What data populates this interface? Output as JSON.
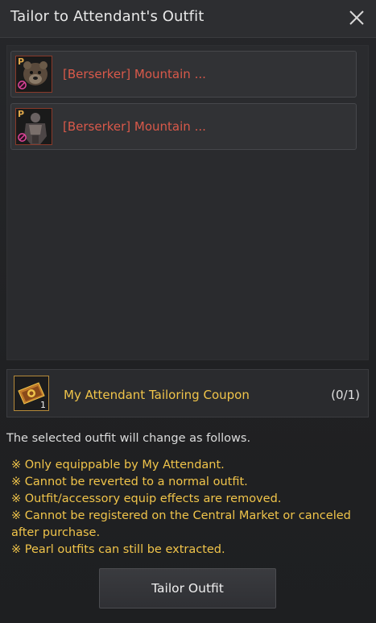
{
  "window": {
    "title": "Tailor to Attendant's Outfit",
    "close_icon": "close-icon"
  },
  "outfits": [
    {
      "name": "[Berserker] Mountain ...",
      "badge": "P",
      "icon": "bear-outfit-icon",
      "status_icon": "prohibited-icon"
    },
    {
      "name": "[Berserker] Mountain ...",
      "badge": "P",
      "icon": "armor-outfit-icon",
      "status_icon": "prohibited-icon"
    }
  ],
  "coupon": {
    "icon": "coupon-icon",
    "count_badge": "1",
    "name": "My Attendant Tailoring Coupon",
    "progress": "(0/1)"
  },
  "description": "The selected outfit will change as follows.",
  "notes": [
    "※ Only equippable by My Attendant.",
    "※ Cannot be reverted to a normal outfit.",
    "※ Outfit/accessory equip effects are removed.",
    "※ Cannot be registered on the Central Market or canceled after purchase.",
    "※ Pearl outfits can still be extracted."
  ],
  "actions": {
    "primary_label": "Tailor Outfit"
  },
  "colors": {
    "accent_gold": "#f0c44a",
    "item_name_red": "#d9594a"
  }
}
